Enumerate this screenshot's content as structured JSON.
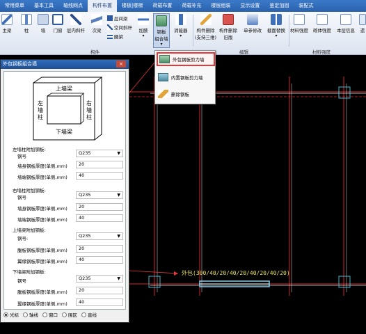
{
  "menu": {
    "tabs": [
      "常用菜单",
      "基本工具",
      "轴线网点",
      "构件布置",
      "楼板|楼梯",
      "荷载布置",
      "荷载补充",
      "楼层组装",
      "显示设置",
      "鉴定加固",
      "装配式"
    ],
    "active_index": 3
  },
  "ribbon": {
    "buttons": {
      "main_beam": "主梁",
      "column": "柱",
      "wall": "墙",
      "door_window": "门窗",
      "diagonal": "层内斜杆",
      "sec_beam": "次梁",
      "add_plate": "加腋",
      "steel_plate_line1": "钢板",
      "steel_plate_line2": "组合墙",
      "damper": "消能器",
      "del_member_line1": "构件删除",
      "del_member_line2": "(支持三维)",
      "del_member2_line1": "构件删除",
      "del_member2_line2": "旧版",
      "single_modify": "单参修改",
      "section_replace": "截面替换",
      "material_strength": "材料强度",
      "masonry_strength": "砌体强度",
      "floor_info": "本层信息",
      "trailing": "遗"
    },
    "small_items": [
      "层间梁",
      "空间斜杆",
      "圈梁"
    ],
    "groups": {
      "components": "构件",
      "edit": "编辑",
      "material": "材料强度"
    }
  },
  "dropdown": {
    "items": [
      "外包钢板剪力墙",
      "内置钢板剪力墙",
      "删除钢板"
    ],
    "highlighted_index": 0
  },
  "dialog": {
    "title": "外包钢板组合墙",
    "close_label": "×",
    "diagram": {
      "top": "上墙梁",
      "bottom": "下墙梁",
      "left": [
        "左",
        "墙",
        "柱"
      ],
      "right": [
        "右",
        "墙",
        "柱"
      ]
    },
    "sections": [
      {
        "title": "左墙柱附加钢板:",
        "rows": [
          {
            "label": "钢号",
            "type": "select",
            "value": "Q235"
          },
          {
            "label": "墙身钢板厚度(单侧,mm)",
            "type": "input",
            "value": "20"
          },
          {
            "label": "墙端钢板厚度(单侧,mm)",
            "type": "input",
            "value": "40"
          }
        ]
      },
      {
        "title": "右墙柱附加钢板:",
        "rows": [
          {
            "label": "钢号",
            "type": "select",
            "value": "Q235"
          },
          {
            "label": "墙身钢板厚度(单侧,mm)",
            "type": "input",
            "value": "20"
          },
          {
            "label": "墙端钢板厚度(单侧,mm)",
            "type": "input",
            "value": "40"
          }
        ]
      },
      {
        "title": "上墙梁附加钢板:",
        "rows": [
          {
            "label": "钢号:",
            "type": "select",
            "value": "Q235"
          },
          {
            "label": "腹板钢板厚度(单侧,mm)",
            "type": "input",
            "value": "20"
          },
          {
            "label": "翼缘钢板厚度(单侧,mm)",
            "type": "input",
            "value": "40"
          }
        ]
      },
      {
        "title": "下墙梁附加钢板:",
        "rows": [
          {
            "label": "钢号",
            "type": "select",
            "value": "Q235"
          },
          {
            "label": "腹板钢板厚度(单侧,mm)",
            "type": "input",
            "value": "20"
          },
          {
            "label": "翼缘钢板厚度(单侧,mm)",
            "type": "input",
            "value": "40"
          }
        ]
      }
    ],
    "radio": {
      "options": [
        "光标",
        "轴线",
        "窗口",
        "围区",
        "直线"
      ],
      "selected_index": 0
    }
  },
  "canvas": {
    "annotation": "外包(300/40/20/40/20/40/20/40/20)"
  },
  "colors": {
    "menubar": "#2b62ad",
    "canvas_bg": "#000000",
    "grid_red": "#d8252a",
    "member_white": "#ffffff",
    "column_cyan": "#4fb5c8",
    "annotation_yellow": "#e8e060",
    "highlight_red": "#e03a3a"
  }
}
